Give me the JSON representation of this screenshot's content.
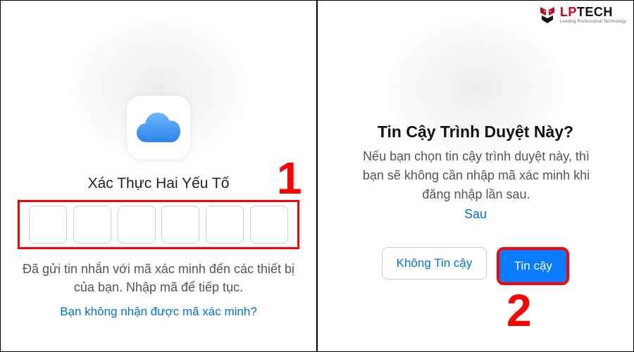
{
  "brand": {
    "name_part1": "LP",
    "name_part2": "TECH",
    "tagline": "Leading Professional Technology"
  },
  "panel1": {
    "title": "Xác Thực Hai Yếu Tố",
    "description": "Đã gửi tin nhắn với mã xác minh đến các thiết bị của bạn. Nhập mã để tiếp tục.",
    "link": "Bạn không nhận được mã xác minh?",
    "code_length": 6,
    "annotation": "1"
  },
  "panel2": {
    "title": "Tin Cậy Trình Duyệt Này?",
    "description": "Nếu bạn chọn tin cậy trình duyệt này, thì bạn sẽ không cần nhập mã xác minh khi đăng nhập lần sau.",
    "later": "Sau",
    "btn_secondary": "Không Tin cậy",
    "btn_primary": "Tin cậy",
    "annotation": "2"
  },
  "colors": {
    "accent": "#0071e3",
    "annotation": "#ff0000",
    "primary_btn": "#0a7cff"
  }
}
